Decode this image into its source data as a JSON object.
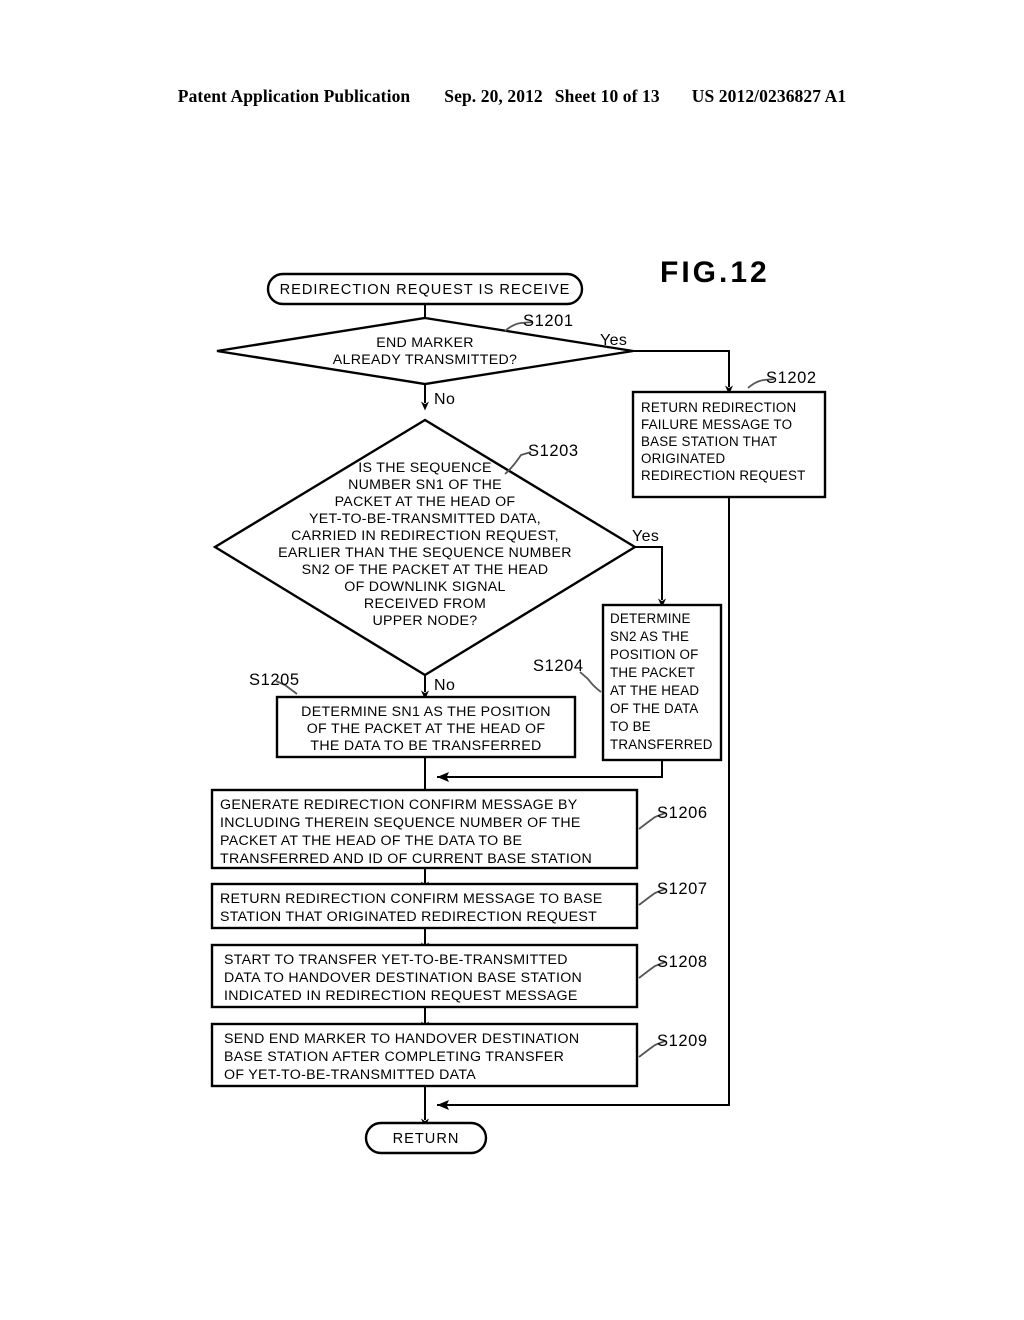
{
  "header": {
    "publication": "Patent Application Publication",
    "date": "Sep. 20, 2012",
    "sheet": "Sheet 10 of 13",
    "pub_number": "US 2012/0236827 A1"
  },
  "figure": {
    "label": "FIG.12"
  },
  "flowchart": {
    "start": {
      "id": "start",
      "shape": "terminator",
      "text": "REDIRECTION REQUEST IS RECEIVE"
    },
    "end": {
      "id": "end",
      "shape": "terminator",
      "text": "RETURN"
    },
    "nodes": [
      {
        "step": "S1201",
        "shape": "decision",
        "lines": [
          "END MARKER",
          "ALREADY TRANSMITTED?"
        ],
        "yes_label": "Yes",
        "no_label": "No"
      },
      {
        "step": "S1202",
        "shape": "process",
        "lines": [
          "RETURN REDIRECTION",
          "FAILURE MESSAGE TO",
          "BASE STATION THAT",
          "ORIGINATED",
          "REDIRECTION REQUEST"
        ]
      },
      {
        "step": "S1203",
        "shape": "decision",
        "lines": [
          "IS THE SEQUENCE",
          "NUMBER SN1 OF THE",
          "PACKET AT THE HEAD OF",
          "YET-TO-BE-TRANSMITTED DATA,",
          "CARRIED IN REDIRECTION REQUEST,",
          "EARLIER THAN THE SEQUENCE NUMBER",
          "SN2 OF THE PACKET AT THE HEAD",
          "OF DOWNLINK SIGNAL",
          "RECEIVED FROM",
          "UPPER NODE?"
        ],
        "yes_label": "Yes",
        "no_label": "No"
      },
      {
        "step": "S1204",
        "shape": "process",
        "lines": [
          "DETERMINE",
          "SN2 AS THE",
          "POSITION OF",
          "THE PACKET",
          "AT THE HEAD",
          "OF THE DATA",
          "TO BE",
          "TRANSFERRED"
        ]
      },
      {
        "step": "S1205",
        "shape": "process",
        "lines": [
          "DETERMINE SN1 AS THE POSITION",
          "OF THE PACKET AT THE HEAD OF",
          "THE DATA TO BE TRANSFERRED"
        ]
      },
      {
        "step": "S1206",
        "shape": "process",
        "lines": [
          "GENERATE REDIRECTION CONFIRM MESSAGE BY",
          "INCLUDING THEREIN SEQUENCE NUMBER OF THE",
          "PACKET AT THE HEAD OF THE DATA TO BE",
          "TRANSFERRED AND ID OF CURRENT BASE STATION"
        ]
      },
      {
        "step": "S1207",
        "shape": "process",
        "lines": [
          "RETURN REDIRECTION CONFIRM MESSAGE TO BASE",
          "STATION THAT ORIGINATED REDIRECTION REQUEST"
        ]
      },
      {
        "step": "S1208",
        "shape": "process",
        "lines": [
          "START TO TRANSFER YET-TO-BE-TRANSMITTED",
          "DATA TO HANDOVER DESTINATION BASE STATION",
          "INDICATED IN REDIRECTION REQUEST MESSAGE"
        ]
      },
      {
        "step": "S1209",
        "shape": "process",
        "lines": [
          "SEND END MARKER TO HANDOVER DESTINATION",
          "BASE STATION AFTER COMPLETING TRANSFER",
          "OF YET-TO-BE-TRANSMITTED DATA"
        ]
      }
    ]
  },
  "colors": {
    "ink": "#000000",
    "leader": "#4a4a4a",
    "paper": "#ffffff"
  }
}
